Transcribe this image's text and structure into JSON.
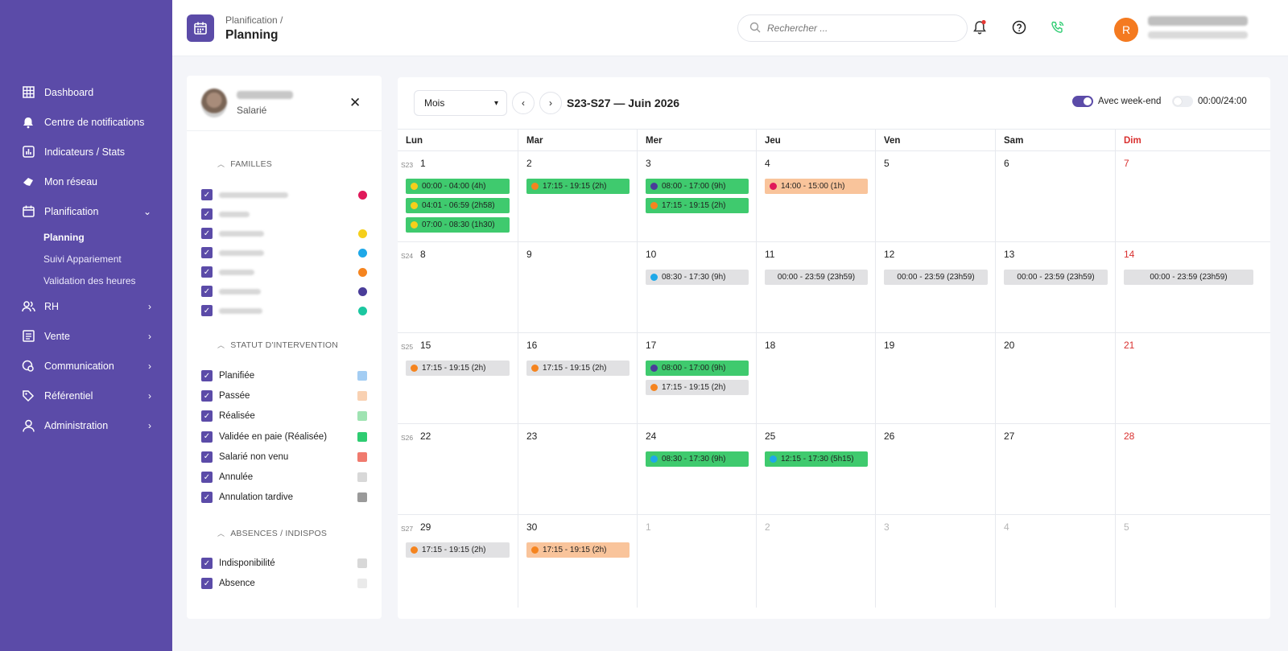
{
  "sidebar": {
    "items": [
      {
        "label": "Dashboard",
        "icon": "grid-icon"
      },
      {
        "label": "Centre de notifications",
        "icon": "bell-icon"
      },
      {
        "label": "Indicateurs / Stats",
        "icon": "chart-icon"
      },
      {
        "label": "Mon réseau",
        "icon": "network-icon"
      },
      {
        "label": "Planification",
        "icon": "calendar-icon",
        "expanded": true
      },
      {
        "label": "RH",
        "icon": "users-icon"
      },
      {
        "label": "Vente",
        "icon": "receipt-icon"
      },
      {
        "label": "Communication",
        "icon": "chat-icon"
      },
      {
        "label": "Référentiel",
        "icon": "tag-icon"
      },
      {
        "label": "Administration",
        "icon": "user-icon"
      }
    ],
    "sub_items": [
      "Planning",
      "Suivi Appariement",
      "Validation des heures"
    ]
  },
  "header": {
    "breadcrumb": "Planification /",
    "title": "Planning",
    "search_placeholder": "Rechercher ...",
    "avatar_letter": "R"
  },
  "filters": {
    "employee_role": "Salarié",
    "sections": [
      {
        "title": "FAMILLES"
      },
      {
        "title": "STATUT D'INTERVENTION"
      },
      {
        "title": "ABSENCES / INDISPOS"
      }
    ],
    "families_dot_colors": [
      "#e0195a",
      "#5b4ba8",
      "#f5cf1b",
      "#1ea8e8",
      "#f5841f",
      "#4a3d99",
      "#1bc7a0"
    ],
    "statuses": [
      {
        "label": "Planifiée",
        "color": "#a3cdf3"
      },
      {
        "label": "Passée",
        "color": "#f9d1b2"
      },
      {
        "label": "Réalisée",
        "color": "#9fe3b2"
      },
      {
        "label": "Validée en paie (Réalisée)",
        "color": "#2ecc71"
      },
      {
        "label": "Salarié non venu",
        "color": "#f07a6e"
      },
      {
        "label": "Annulée",
        "color": "#d8d8d8"
      },
      {
        "label": "Annulation tardive",
        "color": "#9a9a9a"
      }
    ],
    "absences": [
      {
        "label": "Indisponibilité",
        "color": "#d8d8d8"
      },
      {
        "label": "Absence",
        "color": "#eaeaea"
      }
    ]
  },
  "calendar": {
    "mode": "Mois",
    "range_title": "S23-S27 — Juin 2026",
    "weekend_label": "Avec week-end",
    "hours_label": "00:00/24:00",
    "weekend_on": true,
    "hours_on": false,
    "day_headers": [
      "Lun",
      "Mar",
      "Mer",
      "Jeu",
      "Ven",
      "Sam",
      "Dim"
    ],
    "weeks": [
      {
        "label": "S23",
        "days": [
          {
            "n": "1",
            "events": [
              {
                "t": "00:00 - 04:00 (4h)",
                "bg": "#3fca6e",
                "dot": "#f5cf1b"
              },
              {
                "t": "04:01 - 06:59 (2h58)",
                "bg": "#3fca6e",
                "dot": "#f5cf1b"
              },
              {
                "t": "07:00 - 08:30 (1h30)",
                "bg": "#3fca6e",
                "dot": "#f5cf1b"
              }
            ]
          },
          {
            "n": "2",
            "events": [
              {
                "t": "17:15 - 19:15 (2h)",
                "bg": "#3fca6e",
                "dot": "#f5841f"
              }
            ]
          },
          {
            "n": "3",
            "events": [
              {
                "t": "08:00 - 17:00 (9h)",
                "bg": "#3fca6e",
                "dot": "#4a3d99"
              },
              {
                "t": "17:15 - 19:15 (2h)",
                "bg": "#3fca6e",
                "dot": "#f5841f"
              }
            ]
          },
          {
            "n": "4",
            "events": [
              {
                "t": "14:00 - 15:00 (1h)",
                "bg": "#f9c49b",
                "dot": "#e0195a"
              }
            ]
          },
          {
            "n": "5",
            "events": []
          },
          {
            "n": "6",
            "events": []
          },
          {
            "n": "7",
            "events": []
          }
        ]
      },
      {
        "label": "S24",
        "days": [
          {
            "n": "8",
            "events": []
          },
          {
            "n": "9",
            "events": []
          },
          {
            "n": "10",
            "events": [
              {
                "t": "08:30 - 17:30 (9h)",
                "bg": "#e1e1e3",
                "dot": "#1ea8e8"
              }
            ]
          },
          {
            "n": "11",
            "events": [
              {
                "t": "00:00 - 23:59 (23h59)",
                "bg": "#e1e1e3",
                "dot": ""
              }
            ]
          },
          {
            "n": "12",
            "events": [
              {
                "t": "00:00 - 23:59 (23h59)",
                "bg": "#e1e1e3",
                "dot": ""
              }
            ]
          },
          {
            "n": "13",
            "events": [
              {
                "t": "00:00 - 23:59 (23h59)",
                "bg": "#e1e1e3",
                "dot": ""
              }
            ]
          },
          {
            "n": "14",
            "events": [
              {
                "t": "00:00 - 23:59 (23h59)",
                "bg": "#e1e1e3",
                "dot": ""
              }
            ]
          }
        ]
      },
      {
        "label": "S25",
        "days": [
          {
            "n": "15",
            "events": [
              {
                "t": "17:15 - 19:15 (2h)",
                "bg": "#e1e1e3",
                "dot": "#f5841f"
              }
            ]
          },
          {
            "n": "16",
            "events": [
              {
                "t": "17:15 - 19:15 (2h)",
                "bg": "#e1e1e3",
                "dot": "#f5841f"
              }
            ]
          },
          {
            "n": "17",
            "events": [
              {
                "t": "08:00 - 17:00 (9h)",
                "bg": "#3fca6e",
                "dot": "#4a3d99"
              },
              {
                "t": "17:15 - 19:15 (2h)",
                "bg": "#e1e1e3",
                "dot": "#f5841f"
              }
            ]
          },
          {
            "n": "18",
            "events": []
          },
          {
            "n": "19",
            "events": []
          },
          {
            "n": "20",
            "events": []
          },
          {
            "n": "21",
            "events": []
          }
        ]
      },
      {
        "label": "S26",
        "days": [
          {
            "n": "22",
            "events": []
          },
          {
            "n": "23",
            "events": []
          },
          {
            "n": "24",
            "events": [
              {
                "t": "08:30 - 17:30 (9h)",
                "bg": "#3fca6e",
                "dot": "#1ea8e8"
              }
            ]
          },
          {
            "n": "25",
            "events": [
              {
                "t": "12:15 - 17:30 (5h15)",
                "bg": "#3fca6e",
                "dot": "#1ea8e8"
              }
            ]
          },
          {
            "n": "26",
            "events": []
          },
          {
            "n": "27",
            "events": []
          },
          {
            "n": "28",
            "events": []
          }
        ]
      },
      {
        "label": "S27",
        "days": [
          {
            "n": "29",
            "events": [
              {
                "t": "17:15 - 19:15 (2h)",
                "bg": "#e1e1e3",
                "dot": "#f5841f"
              }
            ]
          },
          {
            "n": "30",
            "events": [
              {
                "t": "17:15 - 19:15 (2h)",
                "bg": "#f9c49b",
                "dot": "#f5841f"
              }
            ]
          },
          {
            "n": "1",
            "other": true,
            "events": []
          },
          {
            "n": "2",
            "other": true,
            "events": []
          },
          {
            "n": "3",
            "other": true,
            "events": []
          },
          {
            "n": "4",
            "other": true,
            "events": []
          },
          {
            "n": "5",
            "other": true,
            "events": []
          }
        ]
      }
    ]
  },
  "colors": {
    "brand": "#5b4ba8",
    "sunday": "#d9302f",
    "accent_orange": "#f47a20",
    "phone_green": "#2ecc71",
    "notif_red": "#e53935"
  }
}
